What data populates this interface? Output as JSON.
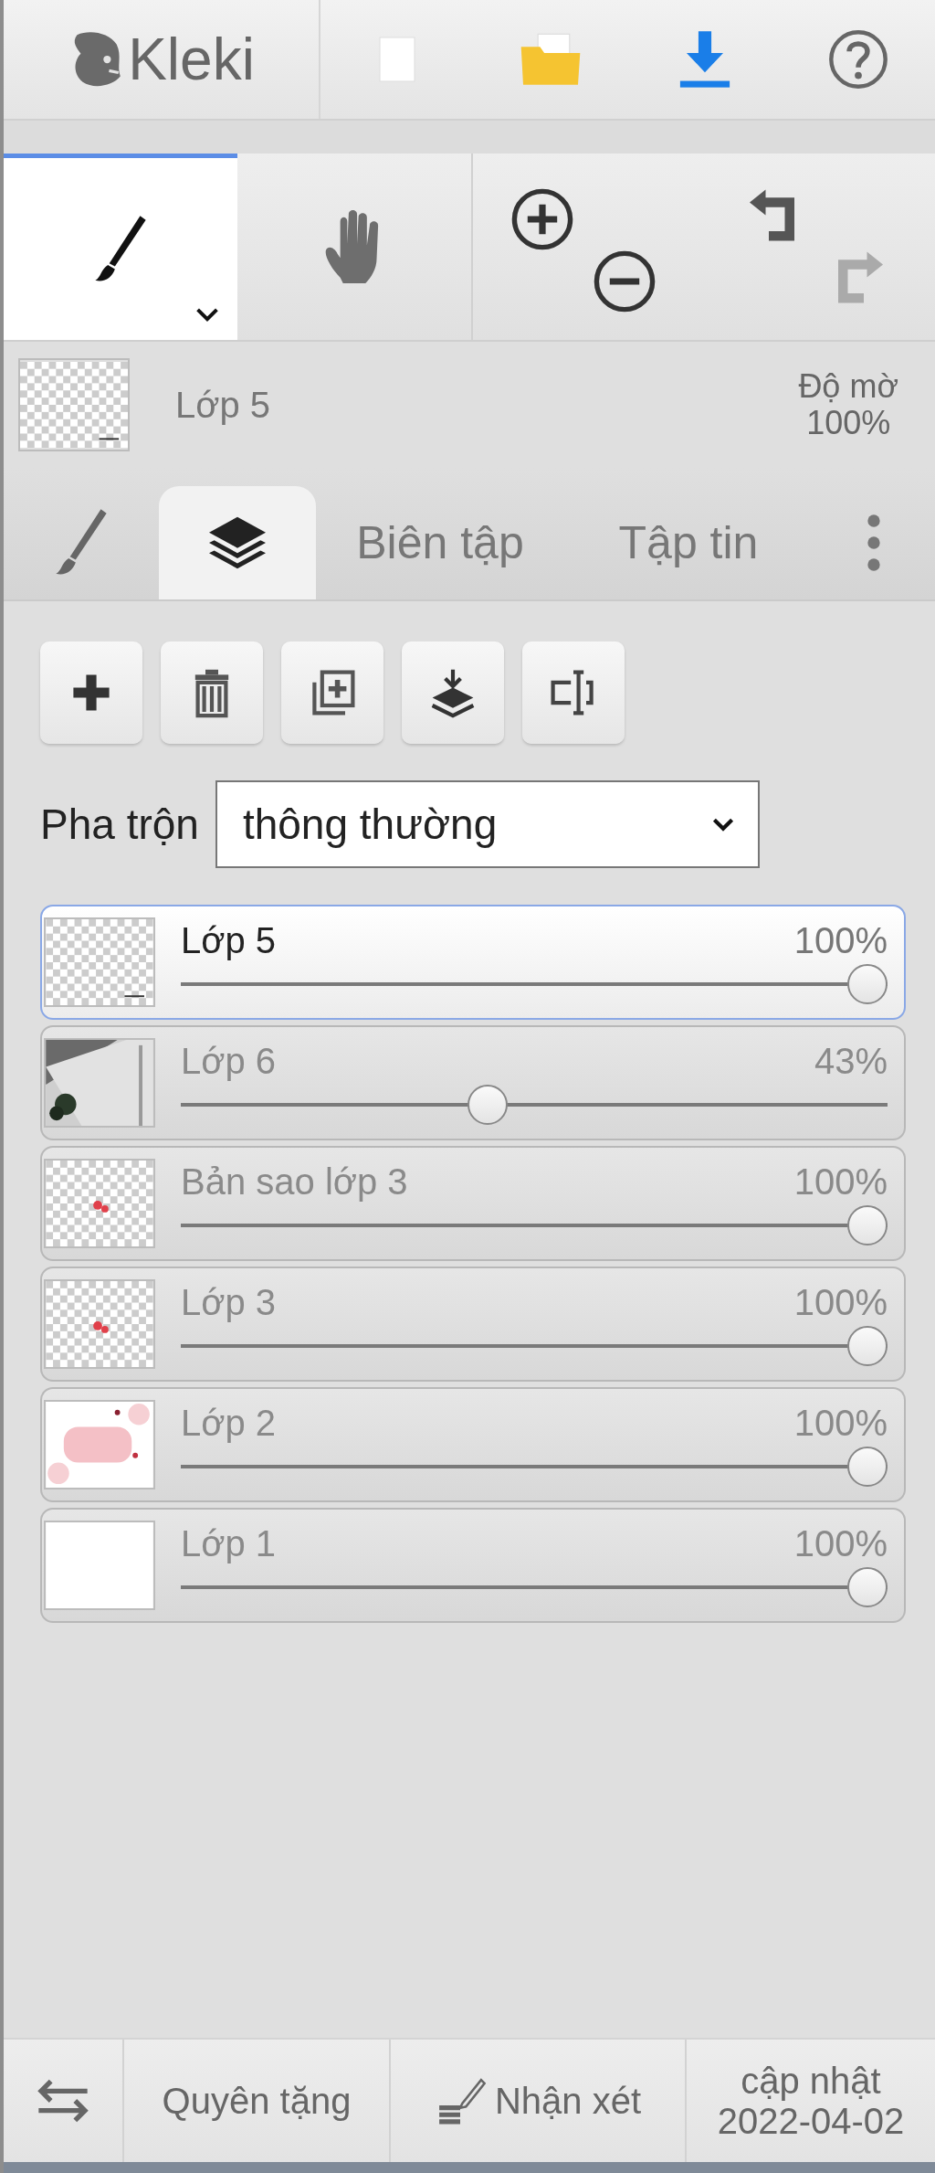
{
  "header": {
    "logo": "Kleki"
  },
  "tools": [
    {
      "kind": "brush",
      "selected": true
    },
    {
      "kind": "hand",
      "selected": false
    }
  ],
  "current_layer": {
    "name": "Lớp 5",
    "opacity_label": "Độ mờ",
    "opacity": "100%"
  },
  "tabs": [
    {
      "kind": "brush",
      "selected": false
    },
    {
      "kind": "layers",
      "selected": true
    },
    {
      "kind": "text",
      "label": "Biên tập",
      "selected": false
    },
    {
      "kind": "text",
      "label": "Tập tin",
      "selected": false
    },
    {
      "kind": "more",
      "selected": false
    }
  ],
  "blend": {
    "label": "Pha trộn",
    "value": "thông thường"
  },
  "layers": [
    {
      "name": "Lớp 5",
      "opacity": "100%",
      "level": 1,
      "selected": true,
      "thumbnail": {
        "kind": "transparent"
      }
    },
    {
      "name": "Lớp 6",
      "opacity": "43%",
      "level": 0.43,
      "selected": false
    },
    {
      "name": "Bản sao lớp 3",
      "opacity": "100%",
      "level": 1,
      "selected": false,
      "thumbnail": {
        "kind": "red-marks"
      }
    },
    {
      "name": "Lớp 3",
      "opacity": "100%",
      "level": 1,
      "selected": false,
      "thumbnail": {
        "kind": "red-marks"
      }
    },
    {
      "name": "Lớp 2",
      "opacity": "100%",
      "level": 1,
      "selected": false,
      "thumbnail": {
        "kind": "pink"
      }
    },
    {
      "name": "Lớp 1",
      "opacity": "100%",
      "level": 1,
      "selected": false,
      "thumbnail": {
        "kind": "white"
      }
    }
  ],
  "footer": [
    {
      "kind": "swap"
    },
    {
      "kind": "text",
      "label": "Quyên tặng"
    },
    {
      "kind": "feedback",
      "label": "Nhận xét"
    },
    {
      "kind": "text",
      "label": "cập nhật 2022-04-02"
    }
  ]
}
